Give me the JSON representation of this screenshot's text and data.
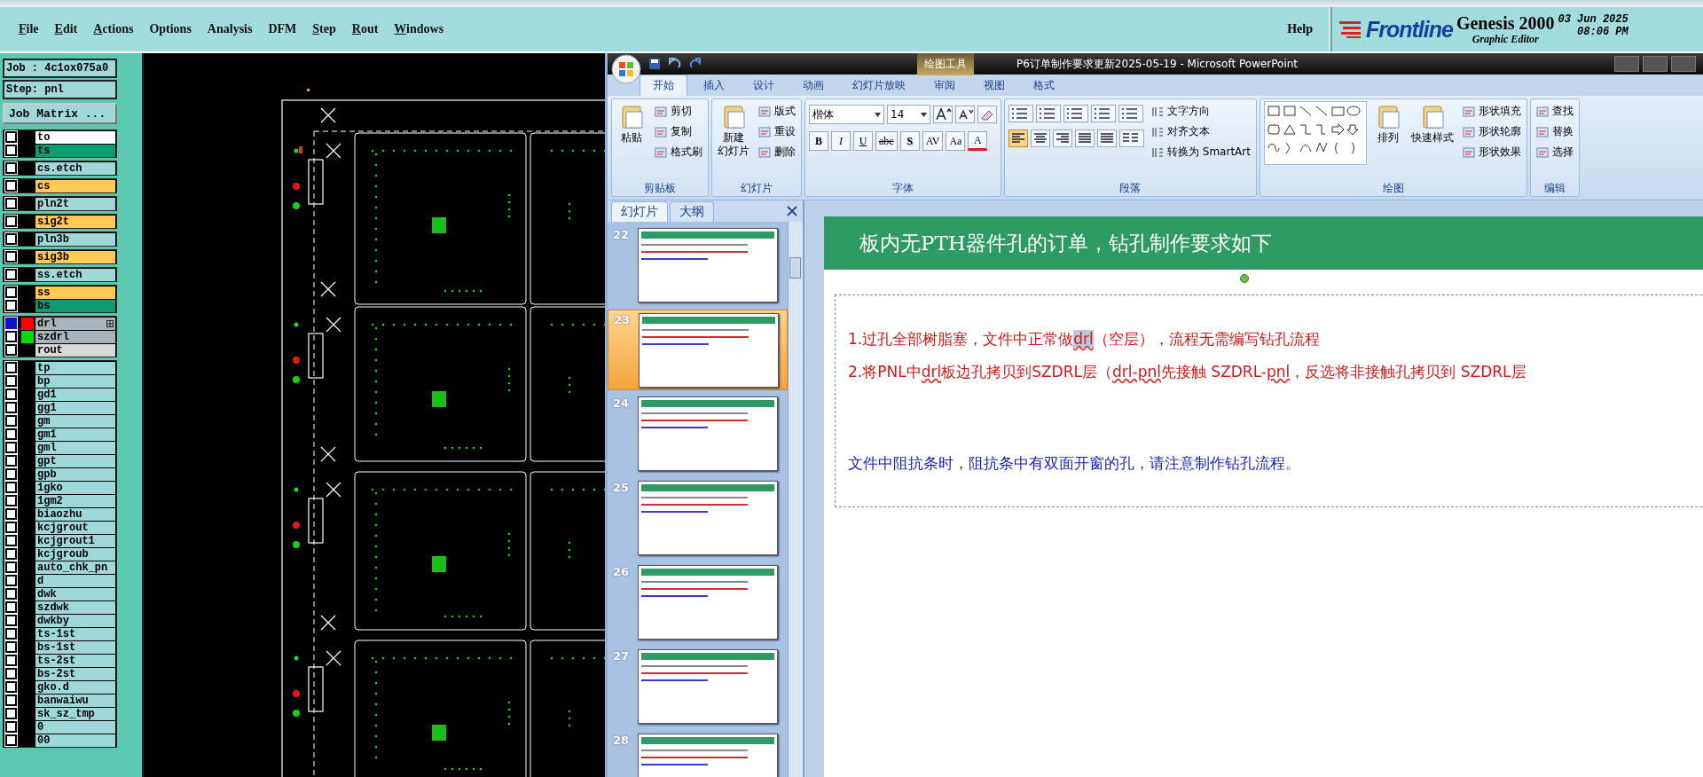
{
  "genesis": {
    "menu": [
      {
        "label": "File",
        "mnemonic": true
      },
      {
        "label": "Edit",
        "mnemonic": true
      },
      {
        "label": "Actions",
        "mnemonic": true
      },
      {
        "label": "Options",
        "mnemonic": false
      },
      {
        "label": "Analysis",
        "mnemonic": false
      },
      {
        "label": "DFM",
        "mnemonic": false
      },
      {
        "label": "Step",
        "mnemonic": true
      },
      {
        "label": "Rout",
        "mnemonic": true
      },
      {
        "label": "Windows",
        "mnemonic": true
      }
    ],
    "help": "Help",
    "logo": "Frontline",
    "product": "Genesis 2000",
    "subtitle": "Graphic Editor",
    "date": "03 Jun 2025",
    "time": "08:06 PM",
    "job": "Job : 4c1ox075a0",
    "step": "Step: pnl",
    "job_matrix": "Job Matrix ...",
    "layer_groups": [
      [
        {
          "name": "to",
          "color": "#ffffff",
          "selected": false,
          "attr_icon": false
        },
        {
          "name": "ts",
          "color": "#0f9a70",
          "selected": false,
          "attr_icon": false
        }
      ],
      [
        {
          "name": "cs.etch",
          "color": "#a0d8d8",
          "selected": false,
          "attr_icon": false
        }
      ],
      [
        {
          "name": "cs",
          "color": "#ffc857",
          "selected": false,
          "attr_icon": false
        }
      ],
      [
        {
          "name": "pln2t",
          "color": "#a0d8d8",
          "selected": false,
          "attr_icon": false
        }
      ],
      [
        {
          "name": "sig2t",
          "color": "#ffc857",
          "selected": false,
          "attr_icon": false
        }
      ],
      [
        {
          "name": "pln3b",
          "color": "#a0d8d8",
          "selected": false,
          "attr_icon": false
        }
      ],
      [
        {
          "name": "sig3b",
          "color": "#ffc857",
          "selected": false,
          "attr_icon": false
        }
      ],
      [
        {
          "name": "ss.etch",
          "color": "#a0d8d8",
          "selected": false,
          "attr_icon": false
        }
      ],
      [
        {
          "name": "ss",
          "color": "#ffc857",
          "selected": false,
          "attr_icon": false
        },
        {
          "name": "bs",
          "color": "#0f9a70",
          "selected": false,
          "attr_icon": false
        }
      ],
      [
        {
          "name": "drl",
          "color": "#a8b4bc",
          "selected": true,
          "swatch": {
            "color": "#ff0000"
          },
          "attr_icon": true
        },
        {
          "name": "szdrl",
          "color": "#a8b4bc",
          "selected": false,
          "swatch": {
            "color": "#00dd00"
          },
          "attr_icon": false
        },
        {
          "name": "rout",
          "color": "#d8d8d8",
          "selected": false,
          "attr_icon": false
        }
      ],
      [
        {
          "name": "tp",
          "color": "#a0d8d8",
          "selected": false,
          "attr_icon": false
        },
        {
          "name": "bp",
          "color": "#a0d8d8",
          "selected": false,
          "attr_icon": false
        },
        {
          "name": "gd1",
          "color": "#a0d8d8",
          "selected": false,
          "attr_icon": false
        },
        {
          "name": "gg1",
          "color": "#a0d8d8",
          "selected": false,
          "attr_icon": false
        },
        {
          "name": "gm",
          "color": "#a0d8d8",
          "selected": false,
          "attr_icon": false
        },
        {
          "name": "gm1",
          "color": "#a0d8d8",
          "selected": false,
          "attr_icon": false
        },
        {
          "name": "gml",
          "color": "#a0d8d8",
          "selected": false,
          "attr_icon": false
        },
        {
          "name": "gpt",
          "color": "#a0d8d8",
          "selected": false,
          "attr_icon": false
        },
        {
          "name": "gpb",
          "color": "#a0d8d8",
          "selected": false,
          "attr_icon": false
        },
        {
          "name": "1gko",
          "color": "#a0d8d8",
          "selected": false,
          "attr_icon": false
        },
        {
          "name": "1gm2",
          "color": "#a0d8d8",
          "selected": false,
          "attr_icon": false
        },
        {
          "name": "biaozhu",
          "color": "#a0d8d8",
          "selected": false,
          "attr_icon": false
        },
        {
          "name": "kcjgrout",
          "color": "#a0d8d8",
          "selected": false,
          "attr_icon": false
        },
        {
          "name": "kcjgrout1",
          "color": "#a0d8d8",
          "selected": false,
          "attr_icon": false
        },
        {
          "name": "kcjgroub",
          "color": "#a0d8d8",
          "selected": false,
          "attr_icon": false
        },
        {
          "name": "auto_chk_pn",
          "color": "#a0d8d8",
          "selected": false,
          "attr_icon": false
        },
        {
          "name": "d",
          "color": "#a0d8d8",
          "selected": false,
          "attr_icon": false
        },
        {
          "name": "dwk",
          "color": "#a0d8d8",
          "selected": false,
          "attr_icon": false
        },
        {
          "name": "szdwk",
          "color": "#a0d8d8",
          "selected": false,
          "attr_icon": false
        },
        {
          "name": "dwkby",
          "color": "#a0d8d8",
          "selected": false,
          "attr_icon": false
        },
        {
          "name": "ts-1st",
          "color": "#a0d8d8",
          "selected": false,
          "attr_icon": false
        },
        {
          "name": "bs-1st",
          "color": "#a0d8d8",
          "selected": false,
          "attr_icon": false
        },
        {
          "name": "ts-2st",
          "color": "#a0d8d8",
          "selected": false,
          "attr_icon": false
        },
        {
          "name": "bs-2st",
          "color": "#a0d8d8",
          "selected": false,
          "attr_icon": false
        },
        {
          "name": "gko.d",
          "color": "#a0d8d8",
          "selected": false,
          "attr_icon": false
        },
        {
          "name": "banwaiwu",
          "color": "#a0d8d8",
          "selected": false,
          "attr_icon": false
        },
        {
          "name": "sk_sz_tmp",
          "color": "#a0d8d8",
          "selected": false,
          "attr_icon": false
        },
        {
          "name": "0",
          "color": "#a0d8d8",
          "selected": false,
          "attr_icon": false
        },
        {
          "name": "00",
          "color": "#a0d8d8",
          "selected": false,
          "attr_icon": false
        }
      ]
    ]
  },
  "powerpoint": {
    "context_label": "绘图工具",
    "title": "P6订单制作要求更新2025-05-19 - Microsoft PowerPoint",
    "tabs": [
      {
        "label": "开始",
        "selected": true
      },
      {
        "label": "插入",
        "selected": false
      },
      {
        "label": "设计",
        "selected": false
      },
      {
        "label": "动画",
        "selected": false
      },
      {
        "label": "幻灯片放映",
        "selected": false
      },
      {
        "label": "审阅",
        "selected": false
      },
      {
        "label": "视图",
        "selected": false
      },
      {
        "label": "格式",
        "selected": false
      }
    ],
    "ribbon": [
      {
        "kind": "standard",
        "label": "剪贴板",
        "large": [
          [
            "粘贴"
          ]
        ],
        "small": [
          "剪切",
          "复制",
          "格式刷"
        ]
      },
      {
        "kind": "standard",
        "label": "幻灯片",
        "large": [
          [
            "新建",
            "幻灯片"
          ]
        ],
        "small": [
          "版式",
          "重设",
          "删除"
        ]
      },
      {
        "kind": "font",
        "label": "字体",
        "font_name": "楷体",
        "font_size": "14",
        "format_buttons": [
          "B",
          "I",
          "U",
          "abc",
          "S",
          "AV",
          "Aa",
          "A"
        ]
      },
      {
        "kind": "paragraph",
        "label": "段落",
        "align_buttons": [
          {
            "selected": true
          },
          {
            "selected": false
          },
          {
            "selected": false
          },
          {
            "selected": false
          },
          {
            "selected": false
          }
        ],
        "small": [
          "文字方向",
          "对齐文本",
          "转换为 SmartArt"
        ]
      },
      {
        "kind": "drawing",
        "label": "绘图",
        "large": [
          [
            "排列"
          ],
          [
            "快速样式"
          ]
        ],
        "small": [
          "形状填充",
          "形状轮廓",
          "形状效果"
        ]
      },
      {
        "kind": "standard",
        "label": "编辑",
        "small": [
          "查找",
          "替换",
          "选择"
        ]
      }
    ],
    "pane_tabs": [
      {
        "label": "幻灯片",
        "selected": true
      },
      {
        "label": "大纲",
        "selected": false
      }
    ],
    "slides": [
      {
        "number": "22",
        "selected": false
      },
      {
        "number": "23",
        "selected": true
      },
      {
        "number": "24",
        "selected": false
      },
      {
        "number": "25",
        "selected": false
      },
      {
        "number": "26",
        "selected": false
      },
      {
        "number": "27",
        "selected": false
      },
      {
        "number": "28",
        "selected": false
      }
    ],
    "slide": {
      "title": "板内无PTH器件孔的订单，钻孔制作要求如下",
      "lines": [
        {
          "color": "#d01818",
          "segments": [
            {
              "text": "1.过孔全部树脂塞，文件中正常做",
              "selected": false,
              "misspelled": false
            },
            {
              "text": "drl",
              "selected": true,
              "misspelled": true
            },
            {
              "text": "（空层），流程无需编写钻孔流程",
              "selected": false,
              "misspelled": false
            }
          ]
        },
        {
          "color": "#d01818",
          "segments": [
            {
              "text": "2.将PNL中",
              "selected": false,
              "misspelled": false
            },
            {
              "text": "drl",
              "selected": false,
              "misspelled": true
            },
            {
              "text": "板边孔拷贝到SZDRL层（",
              "selected": false,
              "misspelled": false
            },
            {
              "text": "drl-pnl",
              "selected": false,
              "misspelled": true
            },
            {
              "text": "先接触 SZDRL-",
              "selected": false,
              "misspelled": false
            },
            {
              "text": "pnl",
              "selected": false,
              "misspelled": true
            },
            {
              "text": "，反选将非接触孔拷贝到 SZDRL层",
              "selected": false,
              "misspelled": false
            }
          ]
        },
        {
          "color": "#1c1cc0",
          "segments": [
            {
              "text": "文件中阻抗条时，阻抗条中有双面开窗的孔，请注意制作钻孔流程。",
              "selected": false,
              "misspelled": false
            }
          ]
        }
      ]
    }
  }
}
